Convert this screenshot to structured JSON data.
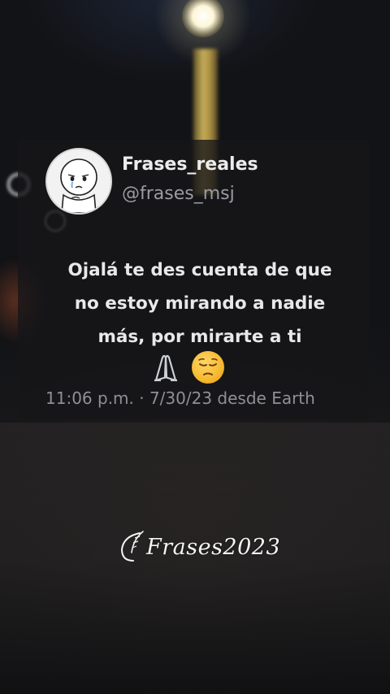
{
  "tweet": {
    "display_name": "Frases_reales",
    "handle": "@frases_msj",
    "text_lines": [
      "Ojalá te des cuenta de que",
      "no estoy mirando a nadie",
      "más, por mirarte a ti"
    ],
    "emojis": [
      "folded-hands-icon",
      "pensive-face-icon"
    ],
    "timestamp": "11:06 p.m. · 7/30/23 desde Earth",
    "avatar_icon": "crying-child-avatar"
  },
  "watermark": {
    "text": "Frases2023",
    "icon": "feather-flourish-icon"
  },
  "background": {
    "description_icons": [
      "street-lamp",
      "bokeh-lights"
    ],
    "lamp_color": "#fdf6d8",
    "pole_color": "#d8bd5f"
  }
}
